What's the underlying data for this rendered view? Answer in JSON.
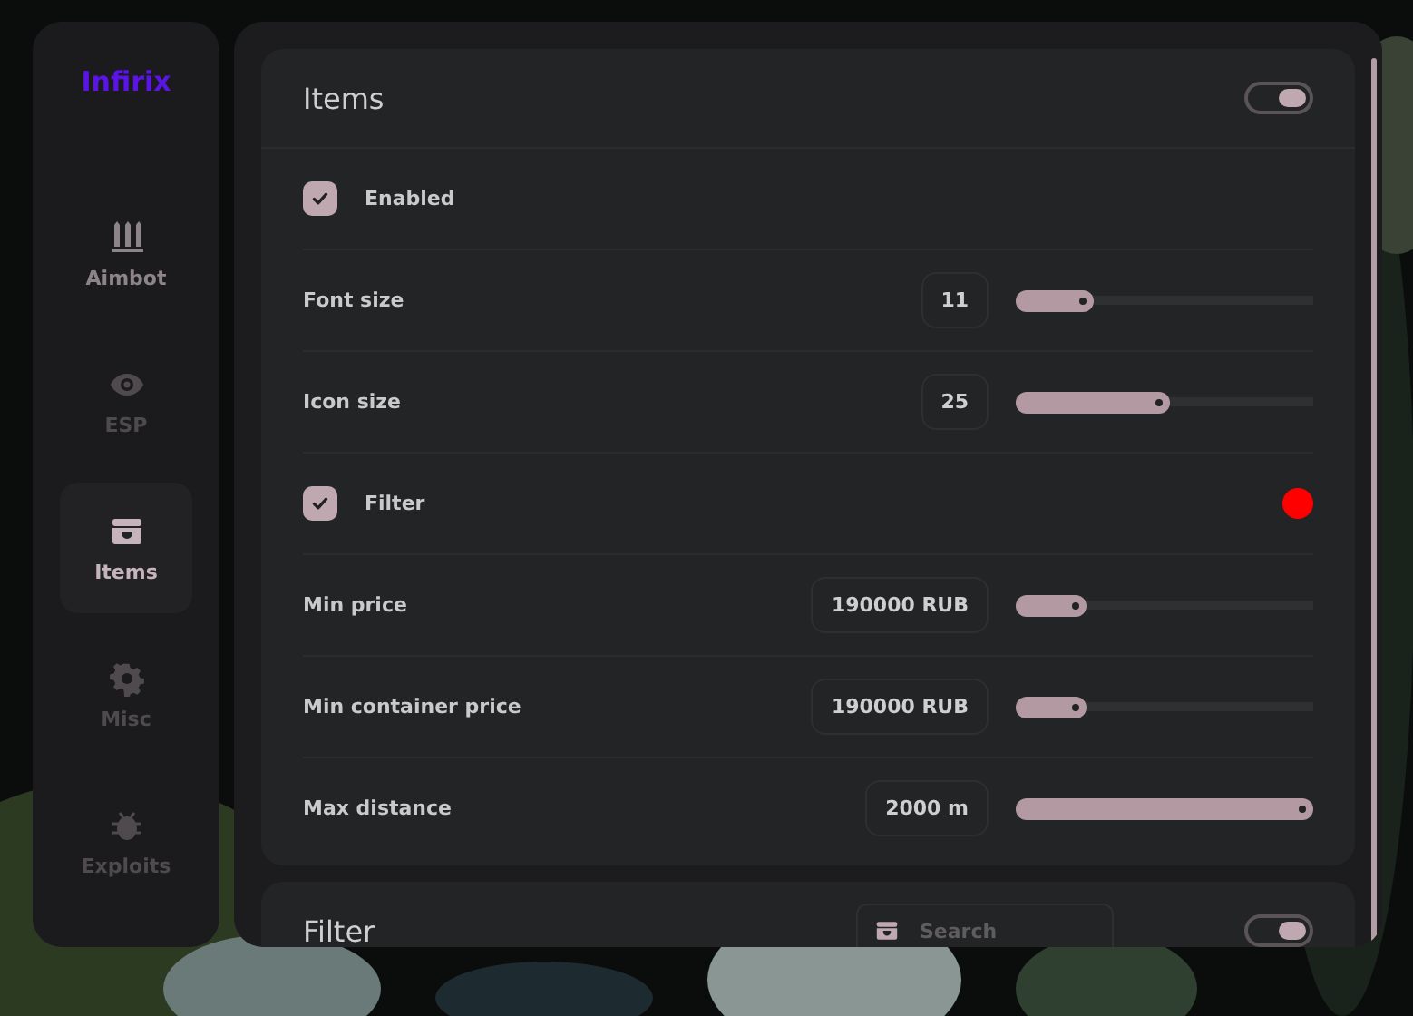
{
  "brand": "Infirix",
  "nav": [
    {
      "label": "Aimbot",
      "selected": false
    },
    {
      "label": "ESP",
      "selected": false
    },
    {
      "label": "Items",
      "selected": true
    },
    {
      "label": "Misc",
      "selected": false
    },
    {
      "label": "Exploits",
      "selected": false
    }
  ],
  "sections": [
    {
      "title": "Items",
      "on": true,
      "rows": [
        {
          "kind": "checkbox",
          "label": "Enabled",
          "checked": true
        },
        {
          "kind": "slider",
          "label": "Font size",
          "reading": "11",
          "level": 0.26
        },
        {
          "kind": "slider",
          "label": "Icon size",
          "reading": "25",
          "level": 0.52
        },
        {
          "kind": "color",
          "label": "Filter",
          "checked": true,
          "color": "#ff0000"
        },
        {
          "kind": "slider",
          "label": "Min price",
          "reading": "190000 RUB",
          "level": 0.24
        },
        {
          "kind": "slider",
          "label": "Min container price",
          "reading": "190000 RUB",
          "level": 0.24
        },
        {
          "kind": "slider",
          "label": "Max distance",
          "reading": "2000 m",
          "level": 1.0
        }
      ]
    },
    {
      "title": "Filter",
      "on": true,
      "search": {
        "placeholder": "Search"
      }
    }
  ]
}
